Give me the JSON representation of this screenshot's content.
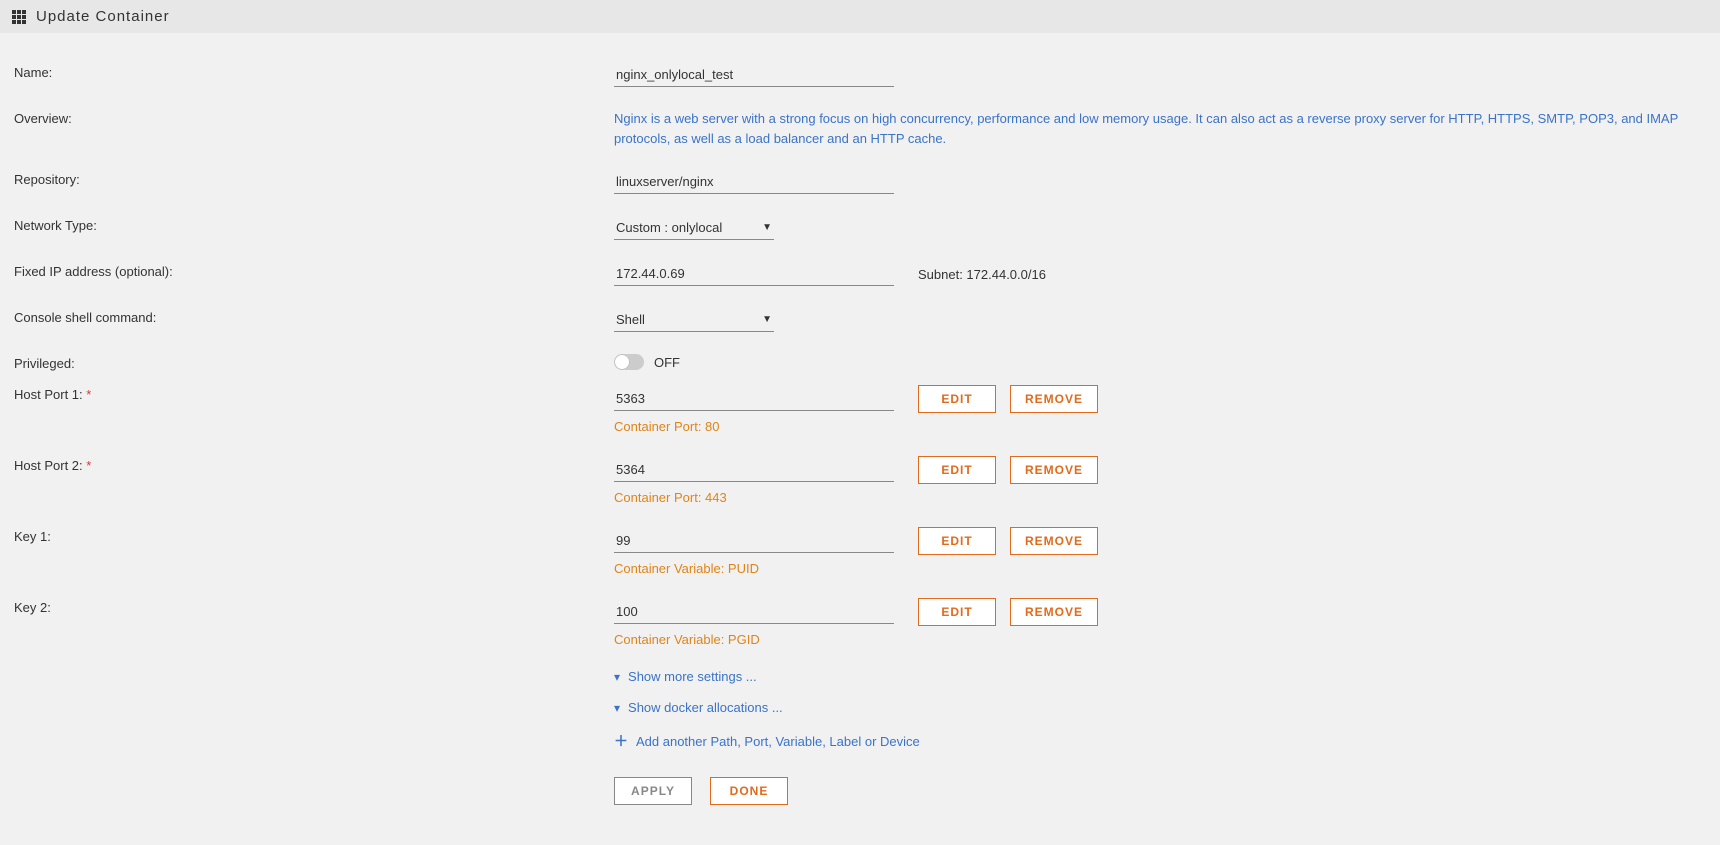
{
  "header": {
    "title": "Update Container"
  },
  "labels": {
    "name": "Name:",
    "overview": "Overview:",
    "repository": "Repository:",
    "network_type": "Network Type:",
    "fixed_ip": "Fixed IP address (optional):",
    "console": "Console shell command:",
    "privileged": "Privileged:",
    "host_port_1": "Host Port 1:",
    "host_port_2": "Host Port 2:",
    "key_1": "Key 1:",
    "key_2": "Key 2:"
  },
  "values": {
    "name": "nginx_onlylocal_test",
    "overview": "Nginx is a web server with a strong focus on high concurrency, performance and low memory usage. It can also act as a reverse proxy server for HTTP, HTTPS, SMTP, POP3, and IMAP protocols, as well as a load balancer and an HTTP cache.",
    "repository": "linuxserver/nginx",
    "network_type": "Custom : onlylocal",
    "fixed_ip": "172.44.0.69",
    "subnet": "Subnet: 172.44.0.0/16",
    "console": "Shell",
    "privileged": "OFF",
    "host_port_1": "5363",
    "host_port_1_sub": "Container Port: 80",
    "host_port_2": "5364",
    "host_port_2_sub": "Container Port: 443",
    "key_1": "99",
    "key_1_sub": "Container Variable: PUID",
    "key_2": "100",
    "key_2_sub": "Container Variable: PGID"
  },
  "buttons": {
    "edit": "Edit",
    "remove": "Remove",
    "apply": "Apply",
    "done": "Done"
  },
  "links": {
    "show_more": "Show more settings ...",
    "show_allocations": "Show docker allocations ...",
    "add_another": "Add another Path, Port, Variable, Label or Device"
  },
  "required_marker": " *"
}
